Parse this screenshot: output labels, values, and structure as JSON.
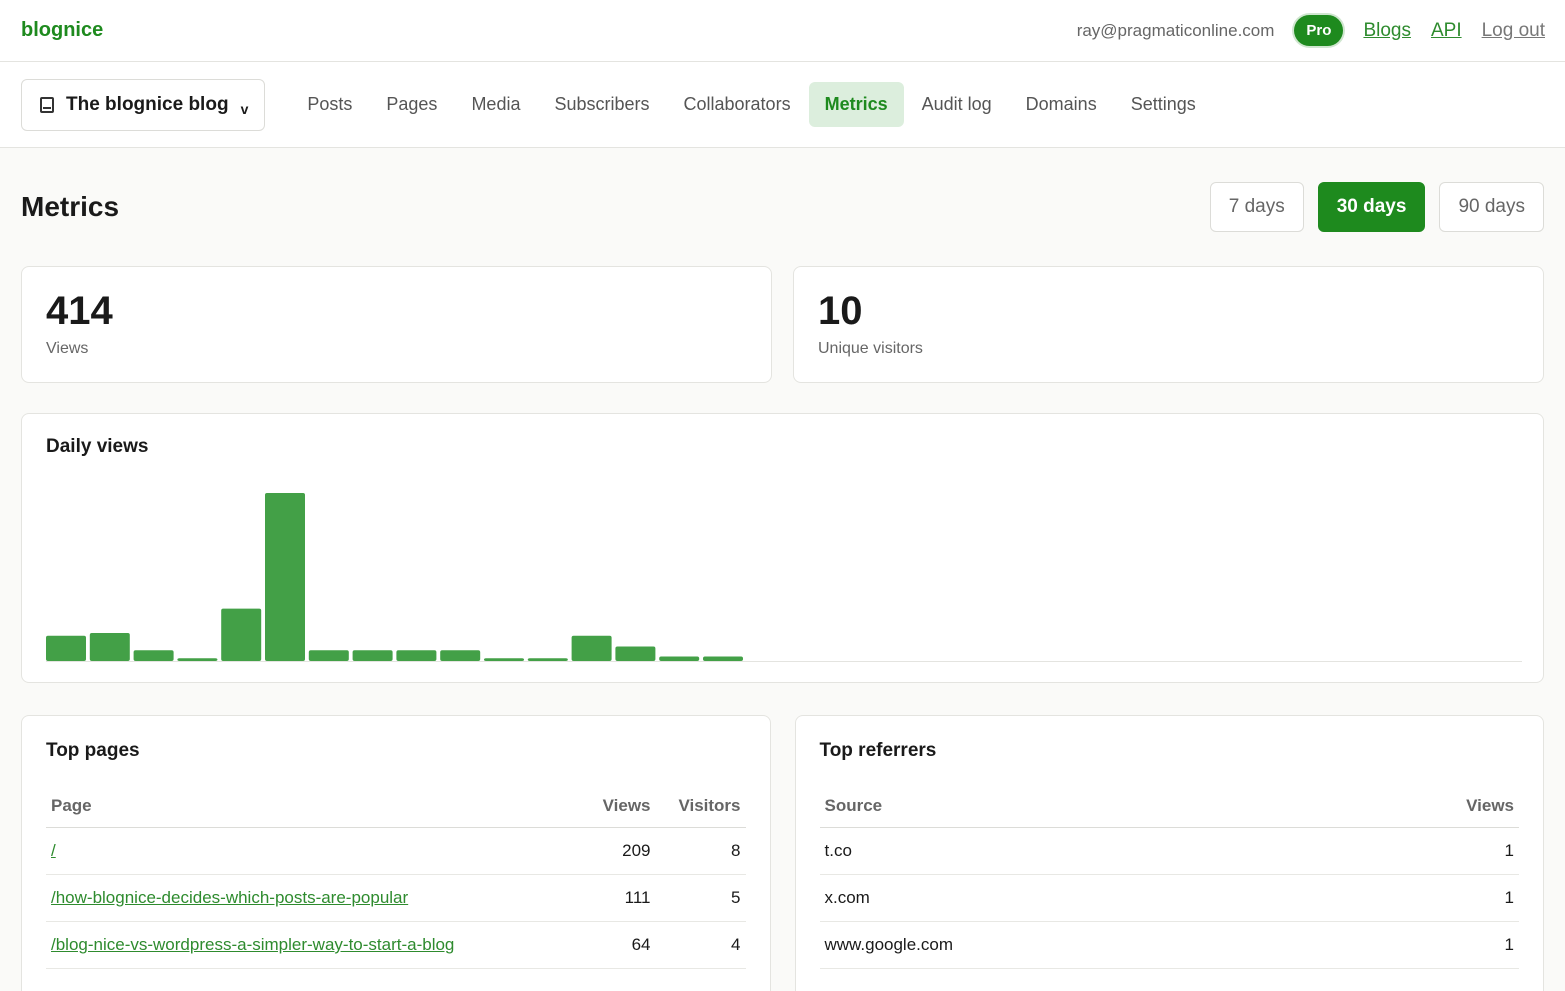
{
  "header": {
    "brand": "blognice",
    "email": "ray@pragmaticonline.com",
    "plan_badge": "Pro",
    "links": [
      "Blogs",
      "API"
    ],
    "logout": "Log out"
  },
  "nav": {
    "blog_name": "The blognice blog",
    "chevron": "v",
    "tabs": [
      {
        "label": "Posts"
      },
      {
        "label": "Pages"
      },
      {
        "label": "Media"
      },
      {
        "label": "Subscribers"
      },
      {
        "label": "Collaborators"
      },
      {
        "label": "Metrics",
        "active": true
      },
      {
        "label": "Audit log"
      },
      {
        "label": "Domains"
      },
      {
        "label": "Settings"
      }
    ]
  },
  "page": {
    "title": "Metrics",
    "ranges": [
      {
        "label": "7 days"
      },
      {
        "label": "30 days",
        "active": true
      },
      {
        "label": "90 days"
      }
    ]
  },
  "stats": {
    "views": "414",
    "views_label": "Views",
    "visitors": "10",
    "visitors_label": "Unique visitors"
  },
  "chart_data": {
    "type": "bar",
    "title": "Daily views",
    "slots": 34,
    "values": [
      28,
      31,
      12,
      3,
      58,
      186,
      12,
      12,
      12,
      12,
      3,
      3,
      28,
      16,
      5,
      5
    ],
    "color": "#43a047"
  },
  "top_pages": {
    "title": "Top pages",
    "columns": [
      "Page",
      "Views",
      "Visitors"
    ],
    "rows": [
      [
        "/",
        "209",
        "8"
      ],
      [
        "/how-blognice-decides-which-posts-are-popular",
        "111",
        "5"
      ],
      [
        "/blog-nice-vs-wordpress-a-simpler-way-to-start-a-blog",
        "64",
        "4"
      ]
    ]
  },
  "top_referrers": {
    "title": "Top referrers",
    "columns": [
      "Source",
      "Views"
    ],
    "rows": [
      [
        "t.co",
        "1"
      ],
      [
        "x.com",
        "1"
      ],
      [
        "www.google.com",
        "1"
      ]
    ]
  }
}
